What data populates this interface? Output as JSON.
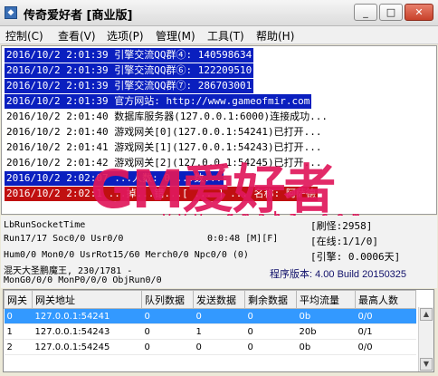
{
  "window": {
    "title": "传奇爱好者 [商业版]",
    "app_icon": "app-icon",
    "buttons": [
      "minimize-icon",
      "maximize-icon",
      "close-icon"
    ]
  },
  "menu": [
    "控制(C)",
    "查看(V)",
    "选项(P)",
    "管理(M)",
    "工具(T)",
    "帮助(H)"
  ],
  "log": [
    {
      "text": "2016/10/2 2:01:39 引擎交流QQ群④: 140598634",
      "style": "sel-blue"
    },
    {
      "text": "2016/10/2 2:01:39 引擎交流QQ群⑥: 122209510",
      "style": "sel-blue"
    },
    {
      "text": "2016/10/2 2:01:39 引擎交流QQ群⑦: 286703001",
      "style": "sel-blue"
    },
    {
      "text": "2016/10/2 2:01:39 官方网站: http://www.gameofmir.com",
      "style": "sel-blue"
    },
    {
      "text": "2016/10/2 2:01:40 数据库服务器(127.0.0.1:6000)连接成功...",
      "style": ""
    },
    {
      "text": "2016/10/2 2:01:40 游戏网关[0](127.0.0.1:54241)已打开...",
      "style": ""
    },
    {
      "text": "2016/10/2 2:01:41 游戏网关[1](127.0.0.1:54243)已打开...",
      "style": ""
    },
    {
      "text": "2016/10/2 2:01:42 游戏网关[2](127.0.0.1:54245)已打开...",
      "style": ""
    },
    {
      "text": "2016/10/2 2:02:07 ...人数: 0 ...数...",
      "style": "sel-blue"
    },
    {
      "text": "2016/10/2 2:02:1 ...掉...错...[ ... ] ... 名称: 阿萨德",
      "style": "sel-red"
    }
  ],
  "watermark": {
    "logo": "GM爱好者",
    "url": "www.gmahz.com"
  },
  "status": {
    "left": [
      "LbRunSocketTime",
      "Run17/17 Soc0/0 Usr0/0",
      "Hum0/0 Mon0/0 UsrRot15/60 Merch0/0 Npc0/0 (0)",
      "混天大圣鹏魔王, 230/1781 -",
      "MonG0/0/0 MonP0/0/0 ObjRun0/0"
    ],
    "timer": "0:0:48 [M][F]",
    "right": [
      "[刷怪:2958]",
      "[在线:1/1/0]",
      "[引擎: 0.0006天]"
    ],
    "version": "程序版本: 4.00 Build 20150325"
  },
  "grid": {
    "headers": [
      "网关",
      "网关地址",
      "队列数据",
      "发送数据",
      "剩余数据",
      "平均流量",
      "最高人数"
    ],
    "rows": [
      [
        "0",
        "127.0.0.1:54241",
        "0",
        "0",
        "0",
        "0b",
        "0/0"
      ],
      [
        "1",
        "127.0.0.1:54243",
        "0",
        "1",
        "0",
        "20b",
        "0/1"
      ],
      [
        "2",
        "127.0.0.1:54245",
        "0",
        "0",
        "0",
        "0b",
        "0/0"
      ]
    ],
    "selected_row": 0
  }
}
